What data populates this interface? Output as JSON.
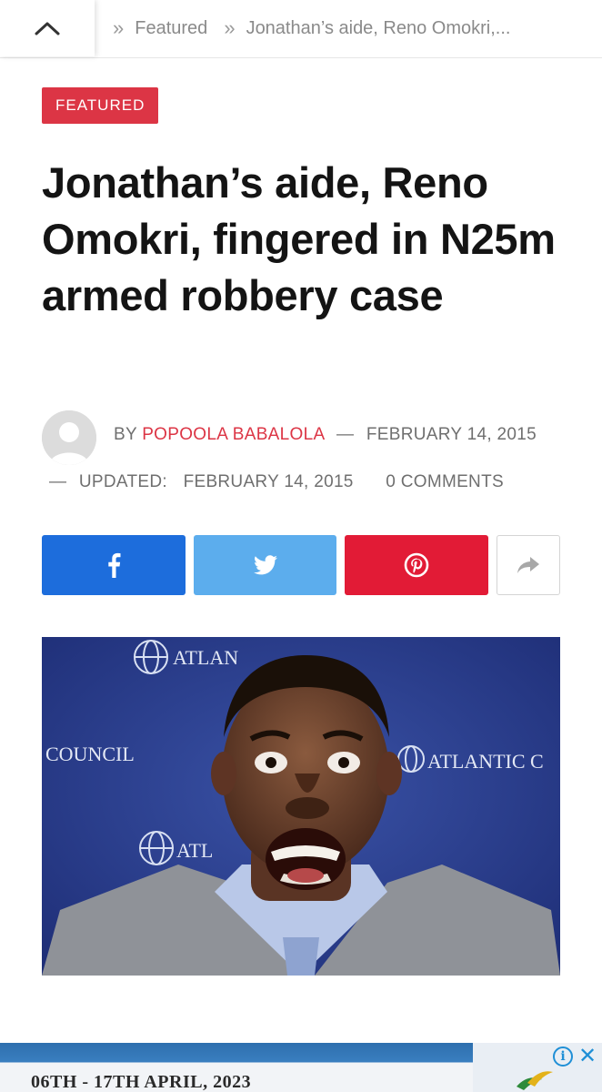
{
  "breadcrumb": {
    "category": "Featured",
    "current": "Jonathan’s aide, Reno Omokri,..."
  },
  "article": {
    "category_tag": "FEATURED",
    "title": "Jonathan’s aide, Reno Omokri, fingered in N25m armed robbery case",
    "by_label": "BY",
    "author": "POPOOLA BABALOLA",
    "published": "FEBRUARY 14, 2015",
    "updated_label": "UPDATED:",
    "updated": "FEBRUARY 14, 2015",
    "comments": "0 COMMENTS"
  },
  "photo": {
    "logo_top": "ATLAN",
    "left_text": "COUNCIL",
    "right_text": "ATLANTIC C",
    "logo_bottom": "ATL"
  },
  "share": {
    "icons": [
      "facebook-icon",
      "twitter-icon",
      "pinterest-icon",
      "share-icon"
    ]
  },
  "ad": {
    "text": "06TH - 17TH APRIL, 2023"
  },
  "colors": {
    "accent": "#dc3545",
    "facebook": "#1d6ddc",
    "twitter": "#5caded",
    "pinterest": "#e21b36"
  }
}
